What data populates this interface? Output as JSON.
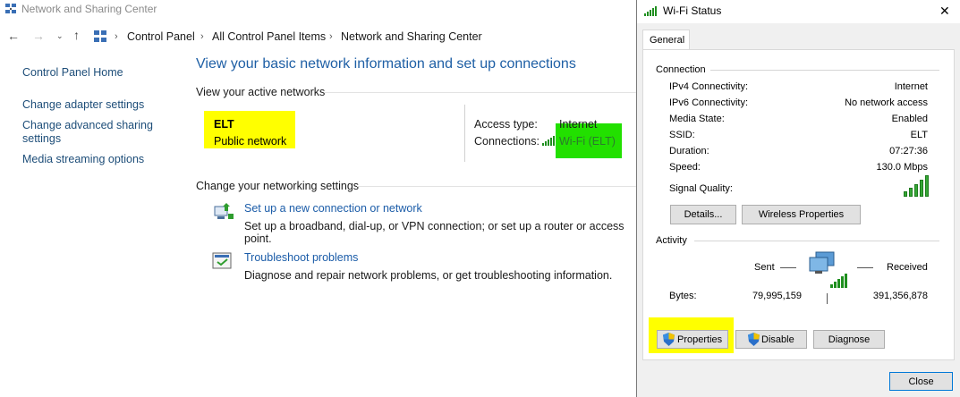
{
  "main": {
    "window_title": "Network and Sharing Center",
    "breadcrumb": [
      "Control Panel",
      "All Control Panel Items",
      "Network and Sharing Center"
    ],
    "sidebar": {
      "home": "Control Panel Home",
      "links": [
        "Change adapter settings",
        "Change advanced sharing settings",
        "Media streaming options"
      ]
    },
    "heading": "View your basic network information and set up connections",
    "active_networks_label": "View your active networks",
    "network": {
      "name": "ELT",
      "type": "Public network",
      "access_type_label": "Access type:",
      "access_type_value": "Internet",
      "connections_label": "Connections:",
      "connection_link": "Wi-Fi (ELT)"
    },
    "change_settings_label": "Change your networking settings",
    "tasks": [
      {
        "title": "Set up a new connection or network",
        "desc": "Set up a broadband, dial-up, or VPN connection; or set up a router or access point."
      },
      {
        "title": "Troubleshoot problems",
        "desc": "Diagnose and repair network problems, or get troubleshooting information."
      }
    ]
  },
  "dialog": {
    "title": "Wi-Fi Status",
    "close_glyph": "✕",
    "tab": "General",
    "connection_label": "Connection",
    "rows": [
      {
        "label": "IPv4 Connectivity:",
        "value": "Internet"
      },
      {
        "label": "IPv6 Connectivity:",
        "value": "No network access"
      },
      {
        "label": "Media State:",
        "value": "Enabled"
      },
      {
        "label": "SSID:",
        "value": "ELT"
      },
      {
        "label": "Duration:",
        "value": "07:27:36"
      },
      {
        "label": "Speed:",
        "value": "130.0 Mbps"
      }
    ],
    "signal_label": "Signal Quality:",
    "signal_bars": 5,
    "details_button": "Details...",
    "wireless_button": "Wireless Properties",
    "activity_label": "Activity",
    "sent_label": "Sent",
    "received_label": "Received",
    "bytes_label": "Bytes:",
    "bytes_sent": "79,995,159",
    "bytes_received": "391,356,878",
    "properties_button": "Properties",
    "disable_button": "Disable",
    "diagnose_button": "Diagnose",
    "close_button": "Close"
  },
  "colors": {
    "highlight_yellow": "#ffff00",
    "highlight_green": "#22e000",
    "link_blue": "#1b5ca8",
    "heading_blue": "#1e5fa5"
  }
}
